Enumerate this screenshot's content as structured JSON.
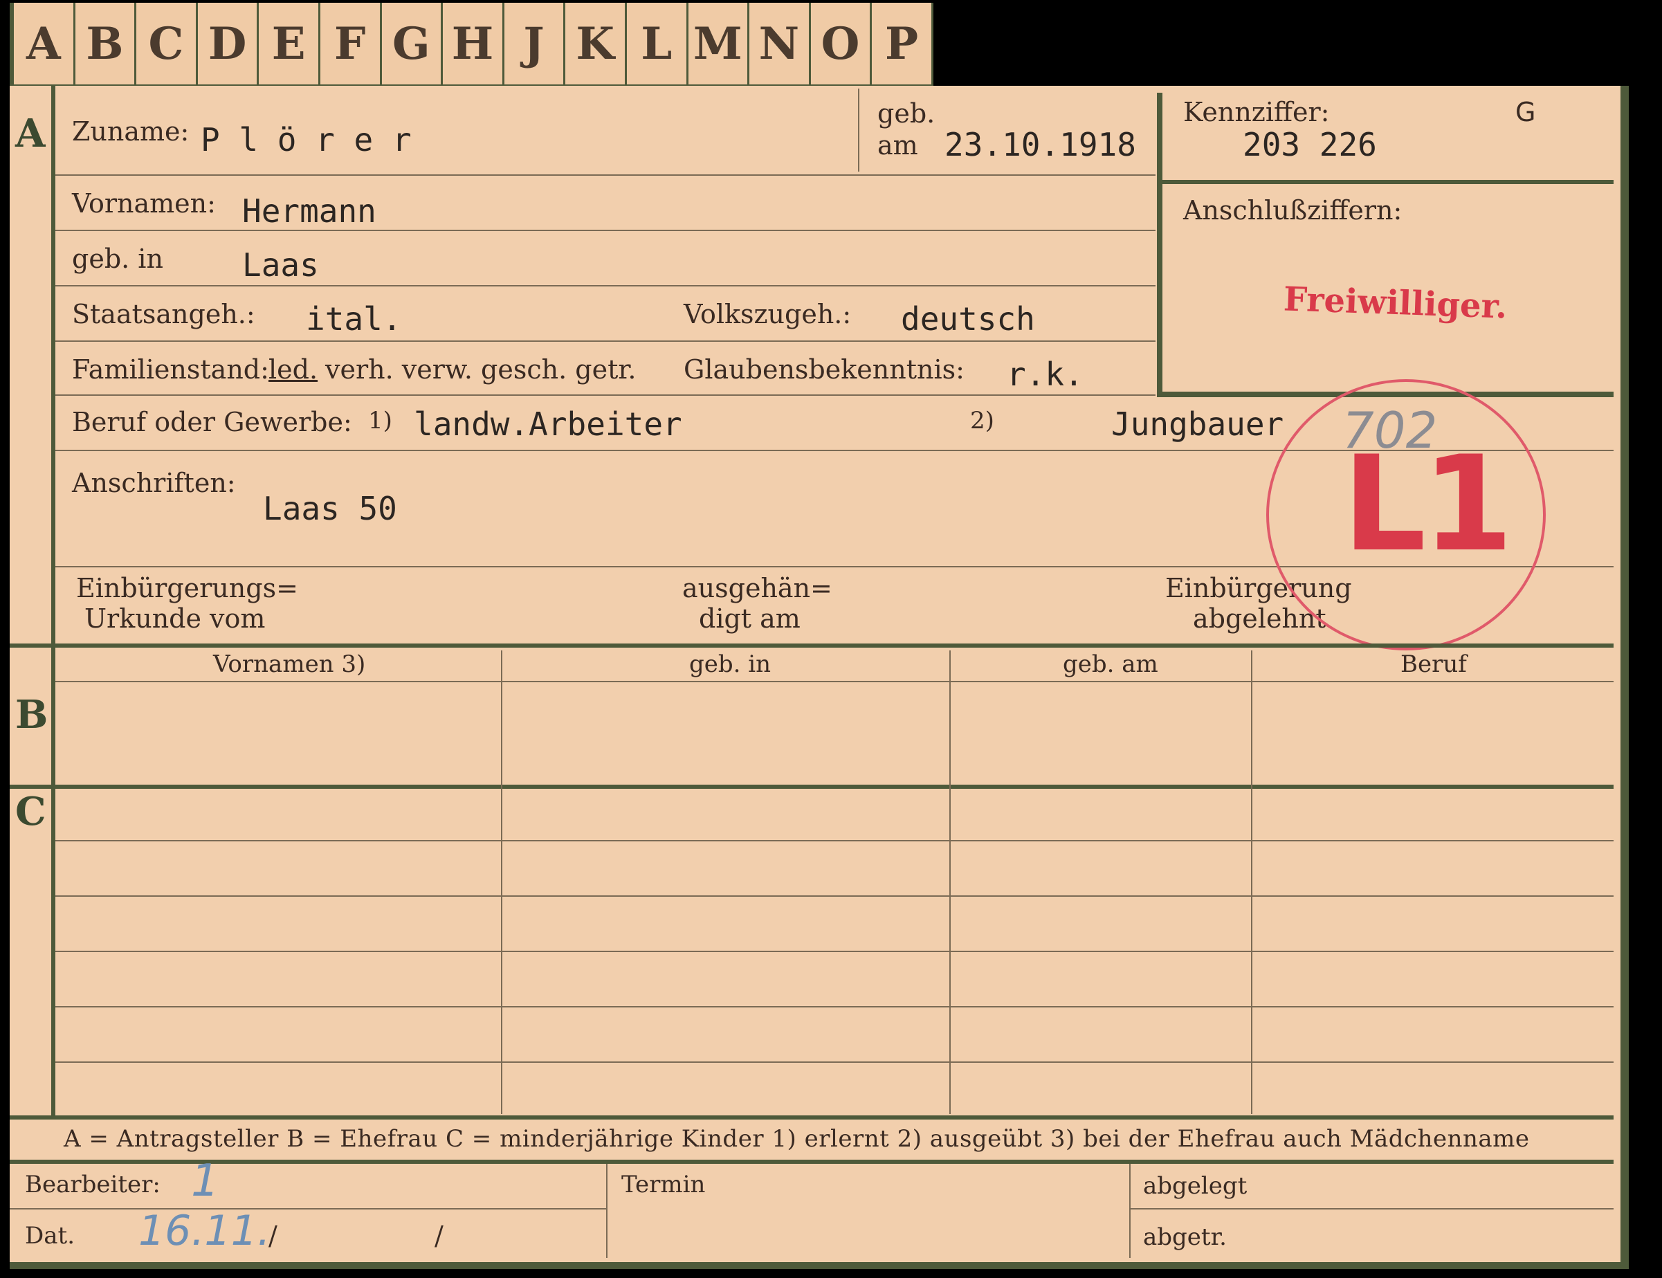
{
  "tabs": [
    "A",
    "B",
    "C",
    "D",
    "E",
    "F",
    "G",
    "H",
    "J",
    "K",
    "L",
    "M",
    "N",
    "O",
    "P"
  ],
  "sections": {
    "a": "A",
    "b": "B",
    "c": "C"
  },
  "fields": {
    "zuname_label": "Zuname:",
    "zuname_value": "P l ö r e r",
    "geb_label": "geb.",
    "am_label": "am",
    "geb_am_value": "23.10.1918",
    "kennziffer_label": "Kennziffer:",
    "kennziffer_value": "203 226",
    "kennziffer_code": "G",
    "vornamen_label": "Vornamen:",
    "vornamen_value": "Hermann",
    "geb_in_label": "geb. in",
    "geb_in_value": "Laas",
    "anschluss_label": "Anschlußziffern:",
    "freiwilliger_stamp": "Freiwilliger.",
    "staatsangeh_label": "Staatsangeh.:",
    "staatsangeh_value": "ital.",
    "volkszugeh_label": "Volkszugeh.:",
    "volkszugeh_value": "deutsch",
    "familienstand_label": "Familienstand:",
    "fam_led": "led.",
    "fam_others": "verh. verw. gesch. getr.",
    "glauben_label": "Glaubensbekenntnis:",
    "glauben_value": "r.k.",
    "beruf_label": "Beruf oder Gewerbe:",
    "beruf_sup1": "1)",
    "beruf_value1": "landw.Arbeiter",
    "beruf_sup2": "2)",
    "beruf_value2": "Jungbauer",
    "anschriften_label": "Anschriften:",
    "anschriften_value": "Laas 50",
    "einb_urkunde_l1": "Einbürgerungs=",
    "einb_urkunde_l2": "Urkunde vom",
    "ausgehaen_l1": "ausgehän=",
    "ausgehaen_l2": "digt am",
    "einb_abgel_l1": "Einbürgerung",
    "einb_abgel_l2": "abgelehnt"
  },
  "stamp": {
    "number": "702",
    "code": "L1"
  },
  "table_b": {
    "headers": [
      "Vornamen 3)",
      "geb. in",
      "geb. am",
      "Beruf"
    ]
  },
  "legend": "A = Antragsteller   B = Ehefrau   C = minderjährige Kinder   1) erlernt   2) ausgeübt   3) bei der Ehefrau auch Mädchenname",
  "footer": {
    "bearbeiter_label": "Bearbeiter:",
    "bearbeiter_value": "1",
    "dat_label": "Dat.",
    "dat_value": "16.11.",
    "slash1": "/",
    "slash2": "/",
    "termin_label": "Termin",
    "abgelegt_label": "abgelegt",
    "abgetr_label": "abgetr."
  }
}
